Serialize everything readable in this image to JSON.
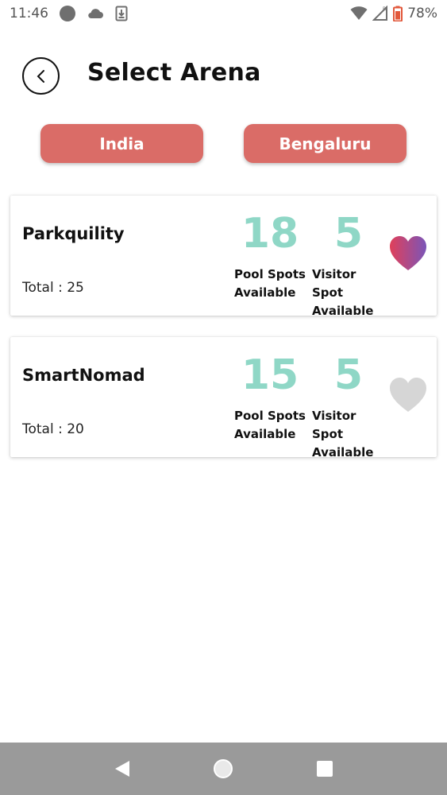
{
  "status_bar": {
    "time": "11:46",
    "battery": "78%"
  },
  "header": {
    "title": "Select Arena"
  },
  "filters": {
    "country": "India",
    "city": "Bengaluru"
  },
  "arenas": [
    {
      "name": "Parkquility",
      "total": "Total : 25",
      "pool_spots": "18",
      "pool_label_line1": "Pool Spots",
      "pool_label_line2": "Available",
      "visitor_spots": "5",
      "visitor_label_line1": "Visitor Spot",
      "visitor_label_line2": "Available",
      "favorite": true
    },
    {
      "name": "SmartNomad",
      "total": "Total : 20",
      "pool_spots": "15",
      "pool_label_line1": "Pool Spots",
      "pool_label_line2": "Available",
      "visitor_spots": "5",
      "visitor_label_line1": "Visitor Spot",
      "visitor_label_line2": "Available",
      "favorite": false
    }
  ],
  "colors": {
    "accent": "#da6c67",
    "stat": "#8fd7c6",
    "heart_active_start": "#e0405a",
    "heart_active_end": "#7b55b8",
    "heart_inactive": "#d6d6d6",
    "nav_bar": "#9a9a9a"
  },
  "icons": {
    "back": "chevron-left-icon",
    "favorite": "heart-icon",
    "nav_back": "triangle-back-icon",
    "nav_home": "circle-home-icon",
    "nav_recents": "square-recents-icon"
  }
}
